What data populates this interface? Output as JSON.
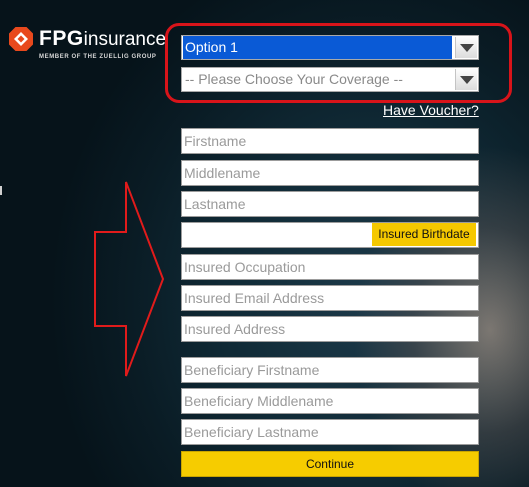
{
  "logo": {
    "brand_bold": "FPG",
    "brand_rest": "insurance",
    "tagline": "MEMBER OF THE ZUELLIG GROUP",
    "accent_color": "#e8491d"
  },
  "form": {
    "option_select": {
      "value": "Option 1"
    },
    "coverage_select": {
      "value": "-- Please Choose Your Coverage --"
    },
    "voucher_link": "Have Voucher?",
    "fields": {
      "firstname": "Firstname",
      "middlename": "Middlename",
      "lastname": "Lastname",
      "occupation": "Insured Occupation",
      "email": "Insured Email Address",
      "address": "Insured Address",
      "ben_firstname": "Beneficiary Firstname",
      "ben_middlename": "Beneficiary Middlename",
      "ben_lastname": "Beneficiary Lastname"
    },
    "birthdate_button": "Insured Birthdate",
    "continue_button": "Continue"
  },
  "colors": {
    "highlight_border": "#d8141a",
    "button_yellow": "#f6cc00",
    "selected_blue": "#0a5ad6"
  }
}
